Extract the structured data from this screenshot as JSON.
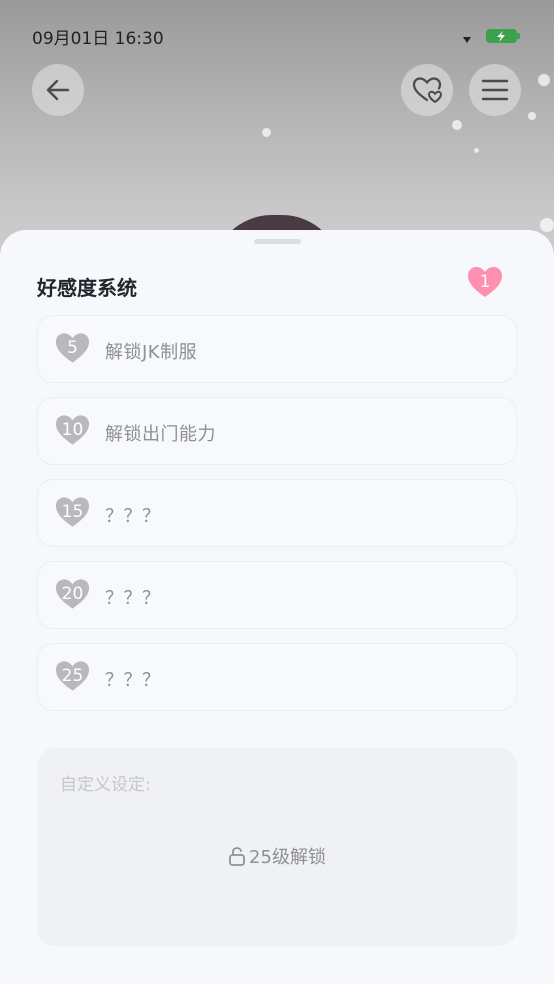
{
  "status_bar": {
    "time": "09月01日  16:30"
  },
  "header": {
    "back_icon": "arrow-left-icon",
    "favorite_icon": "heart-outline-icon",
    "menu_icon": "menu-icon"
  },
  "affection": {
    "title": "好感度系统",
    "current_level": "1",
    "accent_color": "#ff8fb1",
    "locked_heart_color": "#b9b9bd",
    "rewards": [
      {
        "level": "5",
        "label": "解锁JK制服"
      },
      {
        "level": "10",
        "label": "解锁出门能力"
      },
      {
        "level": "15",
        "label": "？？？"
      },
      {
        "level": "20",
        "label": "？？？"
      },
      {
        "level": "25",
        "label": "？？？"
      }
    ]
  },
  "custom_settings": {
    "label": "自定义设定:",
    "lock_text": "25级解锁",
    "lock_icon": "lock-icon"
  }
}
